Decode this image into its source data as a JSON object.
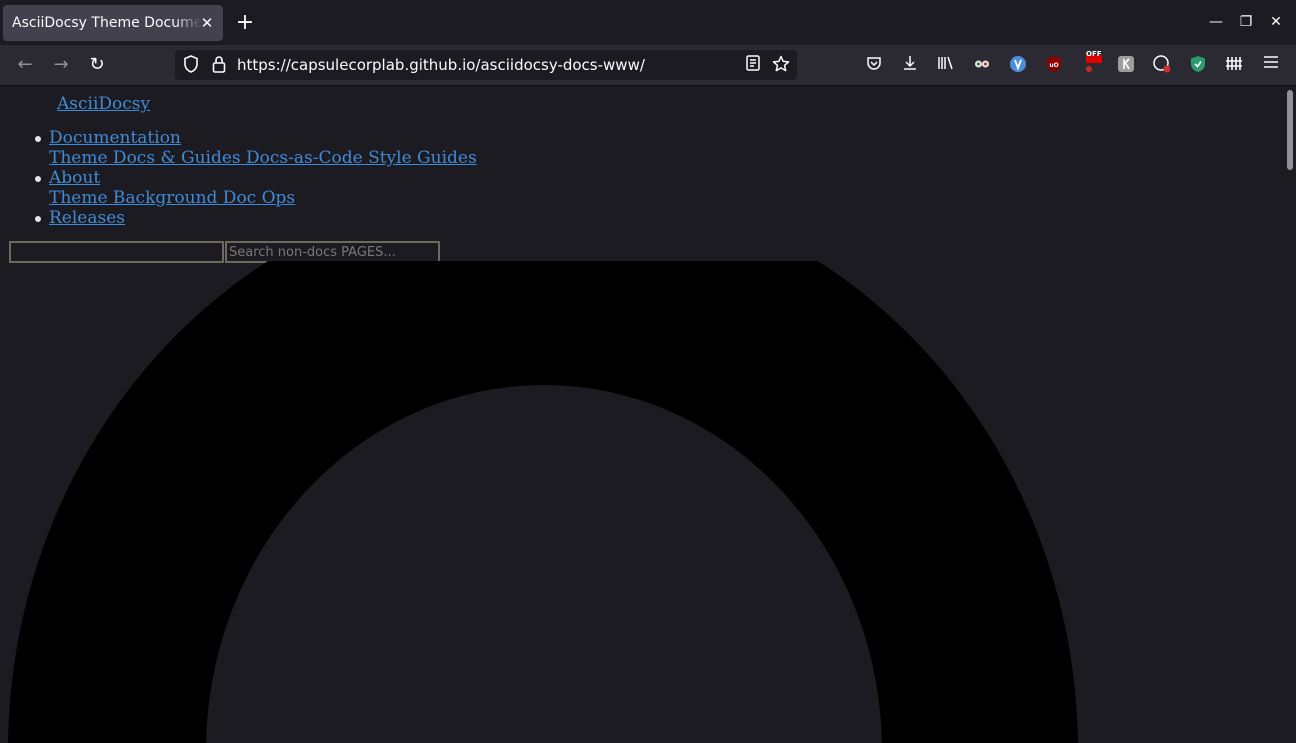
{
  "browser": {
    "tab": {
      "title": "AsciiDocsy Theme Documentation",
      "close": "✕"
    },
    "new_tab": "+",
    "window": {
      "minimize": "—",
      "restore": "❐",
      "close": "✕"
    },
    "nav": {
      "back": "←",
      "forward": "→",
      "reload": "↻"
    },
    "url": "https://capsulecorplab.github.io/asciidocsy-docs-www/",
    "ext_badge": "OFF"
  },
  "page": {
    "brand": " AsciiDocsy",
    "menu": [
      {
        "label": "Documentation",
        "sub": "Theme Docs & Guides Docs-as-Code Style Guides"
      },
      {
        "label": "About",
        "sub": "Theme Background Doc Ops"
      },
      {
        "label": "Releases",
        "sub": ""
      }
    ],
    "search_docs": {
      "placeholder": ""
    },
    "search_pages": {
      "placeholder": "Search non-docs PAGES..."
    }
  },
  "colors": {
    "link": "#3f8bd8",
    "background": "#1c1b22",
    "logo": "#000000"
  }
}
